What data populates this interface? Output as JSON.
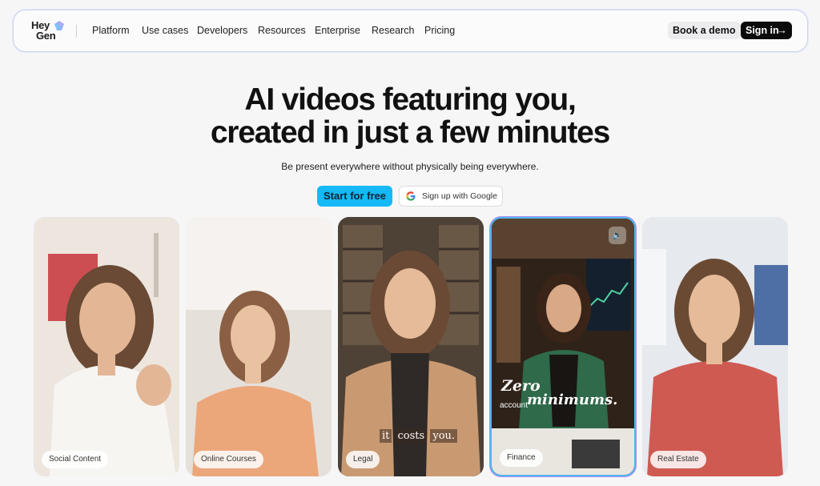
{
  "brand": {
    "line1": "Hey",
    "line2": "Gen"
  },
  "nav": {
    "items": [
      "Platform",
      "Use cases",
      "Developers",
      "Resources",
      "Enterprise",
      "Research",
      "Pricing"
    ],
    "book_demo": "Book a demo",
    "sign_in": "Sign in",
    "sign_in_icon": "arrow-right-icon"
  },
  "hero": {
    "title_line1": "AI videos featuring you,",
    "title_line2": "created in just a few minutes",
    "subtitle": "Be present everywhere without physically being everywhere.",
    "cta_primary": "Start for free",
    "cta_google": "Sign up with Google"
  },
  "cards": [
    {
      "label": "Social Content"
    },
    {
      "label": "Online Courses"
    },
    {
      "label": "Legal",
      "caption": [
        "it",
        "costs",
        "you."
      ]
    },
    {
      "label": "Finance",
      "caption_big1": "Zero",
      "caption_small": "account",
      "caption_big2": "minimums.",
      "active": true,
      "icon": "mute-icon"
    },
    {
      "label": "Real Estate"
    }
  ],
  "colors": {
    "accent": "#14b9f5",
    "dark_button": "#0b0b0b",
    "background": "#f6f6f7"
  }
}
